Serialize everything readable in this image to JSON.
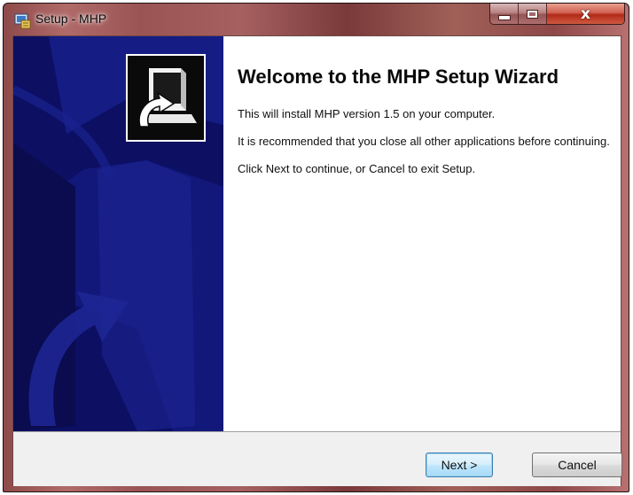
{
  "window": {
    "title": "Setup - MHP",
    "close_glyph": "x",
    "minimize_icon": "minimize-icon",
    "maximize_icon": "maximize-icon",
    "app_icon": "setup-app-icon"
  },
  "wizard": {
    "side_image": "wizard-banner-image",
    "product_image": "computer-install-icon",
    "heading": "Welcome to the MHP Setup Wizard",
    "paragraphs": {
      "p1": "This will install MHP version 1.5 on your computer.",
      "p2": "It is recommended that you close all other applications before continuing.",
      "p3": "Click Next to continue, or Cancel to exit Setup."
    }
  },
  "buttons": {
    "next_label": "Next >",
    "cancel_label": "Cancel"
  },
  "colors": {
    "banner_blue": "#0d0f63",
    "titlebar_accent": "#a06060",
    "close_red": "#c0392b",
    "next_focus_border": "#3c7fb1"
  }
}
